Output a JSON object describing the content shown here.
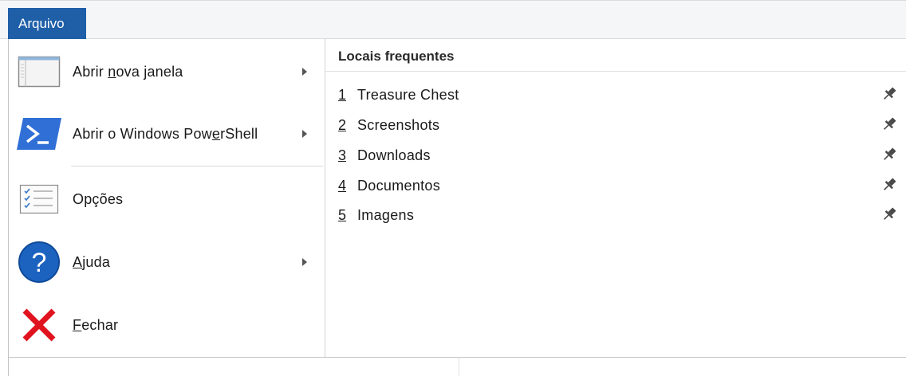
{
  "ribbon": {
    "file_tab": "Arquivo"
  },
  "menu": {
    "items": [
      {
        "pre": "Abrir ",
        "u": "n",
        "post": "ova janela",
        "icon": "new-window-icon",
        "submenu": true
      },
      {
        "pre": "Abrir o Windows Pow",
        "u": "e",
        "post": "rShell",
        "icon": "powershell-icon",
        "submenu": true
      },
      {
        "pre": "Op",
        "u": "",
        "post": "ções",
        "icon": "options-icon",
        "submenu": false
      },
      {
        "pre": "",
        "u": "A",
        "post": "juda",
        "icon": "help-icon",
        "submenu": true
      },
      {
        "pre": "",
        "u": "F",
        "post": "echar",
        "icon": "close-icon",
        "submenu": false
      }
    ]
  },
  "frequent": {
    "title": "Locais frequentes",
    "items": [
      {
        "num": "1",
        "name": "Treasure Chest",
        "icon": "pin-icon"
      },
      {
        "num": "2",
        "name": "Screenshots",
        "icon": "pin-icon"
      },
      {
        "num": "3",
        "name": "Downloads",
        "icon": "pin-icon"
      },
      {
        "num": "4",
        "name": "Documentos",
        "icon": "pin-icon"
      },
      {
        "num": "5",
        "name": "Imagens",
        "icon": "pin-icon"
      }
    ]
  },
  "colors": {
    "file_tab": "#1f5fa8",
    "powershell": "#2f6fd6",
    "help": "#1c63c0",
    "close": "#e0141f"
  }
}
